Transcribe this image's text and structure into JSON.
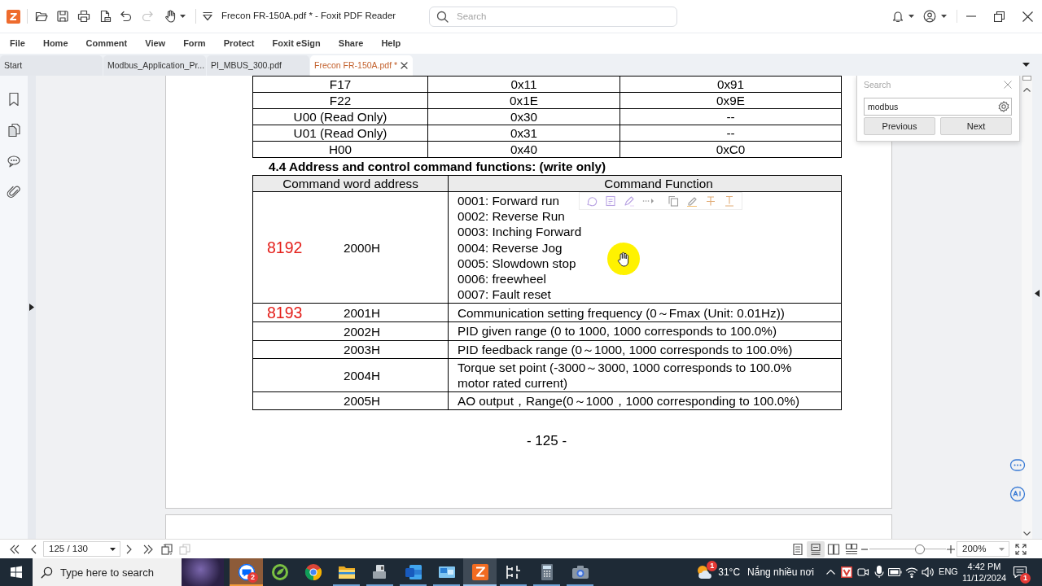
{
  "title_bar": {
    "title": "Frecon FR-150A.pdf * - Foxit PDF Reader",
    "search": {
      "placeholder": "Search"
    },
    "quick_tools": [
      {
        "kind": "open",
        "disabled": false
      },
      {
        "kind": "save",
        "disabled": false
      },
      {
        "kind": "print",
        "disabled": false
      },
      {
        "kind": "export",
        "disabled": false
      },
      {
        "kind": "undo",
        "disabled": false
      },
      {
        "kind": "redo",
        "disabled": true
      },
      {
        "kind": "hand",
        "disabled": false
      }
    ]
  },
  "menu": [
    "File",
    "Home",
    "Comment",
    "View",
    "Form",
    "Protect",
    "Foxit eSign",
    "Share",
    "Help"
  ],
  "tabs": [
    {
      "label": "Start",
      "selected": false
    },
    {
      "label": "Modbus_Application_Pr...",
      "selected": false
    },
    {
      "label": "PI_MBUS_300.pdf",
      "selected": false
    },
    {
      "label": "Frecon FR-150A.pdf *",
      "selected": true
    }
  ],
  "document": {
    "register_table": {
      "rows": [
        [
          "F17",
          "0x11",
          "0x91"
        ],
        [
          "F22",
          "0x1E",
          "0x9E"
        ],
        [
          "U00 (Read Only)",
          "0x30",
          "--"
        ],
        [
          "U01 (Read Only)",
          "0x31",
          "--"
        ],
        [
          "H00",
          "0x40",
          "0xC0"
        ]
      ]
    },
    "heading": "4.4 Address and control command functions: (write only)",
    "command_table": {
      "columns": [
        "Command word address",
        "Command Function"
      ],
      "rows": [
        {
          "note": "8192",
          "address": "2000H",
          "function": [
            "0001: Forward run",
            "0002: Reverse Run",
            "0003: Inching Forward",
            "0004: Reverse Jog",
            "0005: Slowdown stop",
            "0006: freewheel",
            "0007: Fault reset"
          ]
        },
        {
          "note": "8193",
          "address": "2001H",
          "function": [
            "Communication setting frequency (0～Fmax (Unit: 0.01Hz))"
          ]
        },
        {
          "address": "2002H",
          "function": [
            "PID given range (0 to 1000, 1000 corresponds to 100.0%)"
          ]
        },
        {
          "address": "2003H",
          "function": [
            "PID feedback range (0～1000, 1000 corresponds to 100.0%)"
          ]
        },
        {
          "address": "2004H",
          "function": [
            "Torque set point (-3000～3000, 1000 corresponds to 100.0% motor rated current)"
          ]
        },
        {
          "address": "2005H",
          "function": [
            "AO output，Range(0～1000，1000 corresponding to 100.0%)"
          ]
        }
      ]
    },
    "page_number": "- 125 -"
  },
  "search_panel": {
    "title": "Search",
    "query": "modbus",
    "buttons": [
      "Previous",
      "Next"
    ]
  },
  "status_bar": {
    "page": "125 / 130",
    "view_modes": [
      {
        "kind": "single",
        "selected": false
      },
      {
        "kind": "continuous",
        "selected": true
      },
      {
        "kind": "facing",
        "selected": false
      },
      {
        "kind": "continuous_facing",
        "selected": false
      }
    ],
    "zoom": {
      "level": 0.66,
      "value": "200%"
    }
  },
  "taskbar": {
    "search": {
      "placeholder": "Type here to search"
    },
    "apps": [
      {
        "kind": "chat",
        "running": true,
        "active": false,
        "flashing": true,
        "badge": "2"
      },
      {
        "kind": "green_browser",
        "running": false,
        "active": false,
        "flashing": false
      },
      {
        "kind": "browser",
        "running": false,
        "active": false,
        "flashing": false
      },
      {
        "kind": "folder",
        "running": true,
        "active": false,
        "flashing": false
      },
      {
        "kind": "devices",
        "running": true,
        "active": false,
        "flashing": false
      },
      {
        "kind": "document",
        "running": true,
        "active": false,
        "flashing": false
      },
      {
        "kind": "window",
        "running": true,
        "active": false,
        "flashing": false
      },
      {
        "kind": "pdf",
        "running": true,
        "active": true,
        "flashing": false
      },
      {
        "kind": "tool",
        "running": true,
        "active": false,
        "flashing": false
      },
      {
        "kind": "calculator",
        "running": true,
        "active": false,
        "flashing": false
      },
      {
        "kind": "camera",
        "running": true,
        "active": false,
        "flashing": false
      }
    ],
    "weather": {
      "badge": "1",
      "temperature": "31°C",
      "condition": "Nắng nhiều nơi"
    },
    "language": "ENG",
    "time": "4:42 PM",
    "date": "11/12/2024",
    "notifications": {
      "badge": "1"
    }
  }
}
